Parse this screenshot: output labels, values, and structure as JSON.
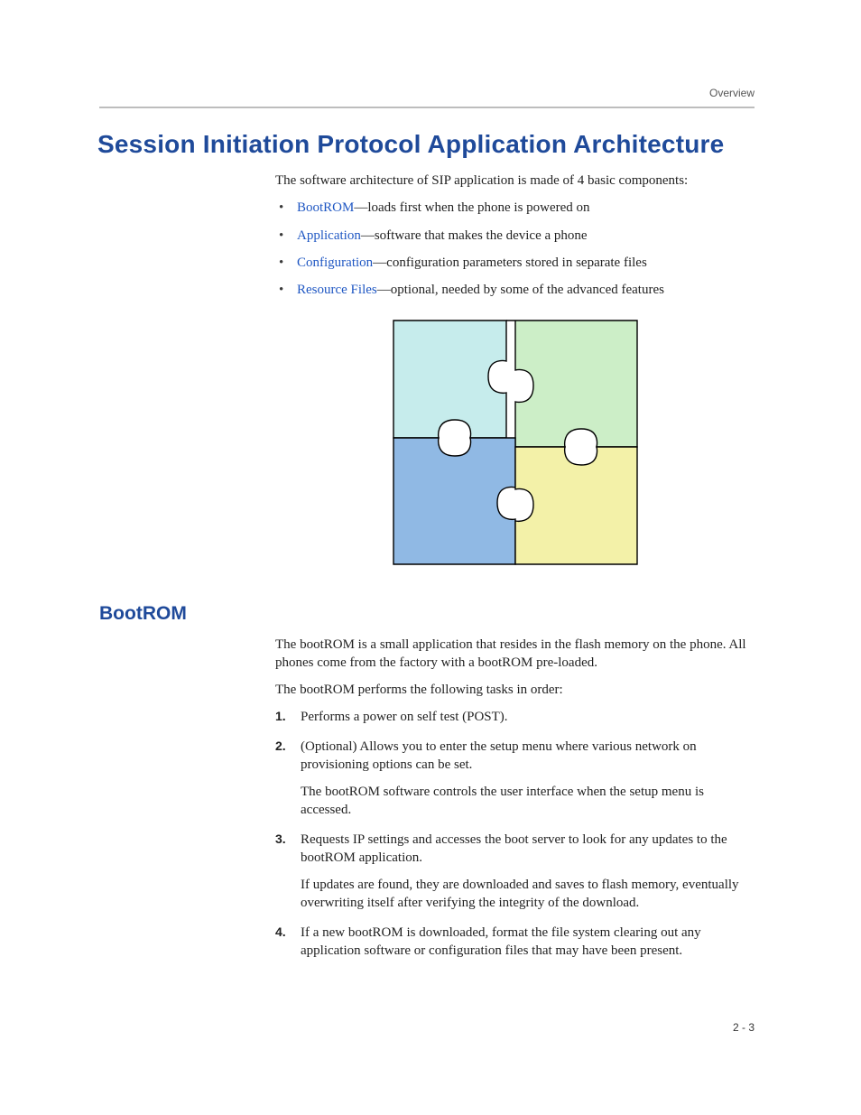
{
  "header": {
    "right": "Overview"
  },
  "title": "Session Initiation Protocol Application Architecture",
  "intro": "The software architecture of SIP application is made of 4 basic components:",
  "bullets": [
    {
      "link": "BootROM",
      "rest": "—loads first when the phone is powered on"
    },
    {
      "link": "Application",
      "rest": "—software that makes the device a phone"
    },
    {
      "link": "Configuration",
      "rest": "—configuration parameters stored in separate files"
    },
    {
      "link": "Resource Files",
      "rest": "—optional, needed by some of the advanced features"
    }
  ],
  "section": {
    "heading": "BootROM",
    "p1": "The bootROM is a small application that resides in the flash memory on the phone. All phones come from the factory with a bootROM pre-loaded.",
    "p2": "The bootROM performs the following tasks in order:",
    "steps": {
      "s1": {
        "a": "Performs a power on self test (POST)."
      },
      "s2": {
        "a": "(Optional) Allows you to enter the setup menu where various network on provisioning options can be set.",
        "b": "The bootROM software controls the user interface when the setup menu is accessed."
      },
      "s3": {
        "a": "Requests IP settings and accesses the boot server to look for any updates to the bootROM application.",
        "b": "If updates are found, they are downloaded and saves to flash memory, eventually overwriting itself after verifying the integrity of the download."
      },
      "s4": {
        "a": "If a new bootROM is downloaded, format the file system clearing out any application software or configuration files that may have been present."
      }
    }
  },
  "pageNumber": "2 - 3",
  "figure": {
    "colors": {
      "topLeft": "#c6ecec",
      "topRight": "#cceec7",
      "bottomLeft": "#90b9e4",
      "bottomRight": "#f3f1a8",
      "stroke": "#000000"
    }
  }
}
